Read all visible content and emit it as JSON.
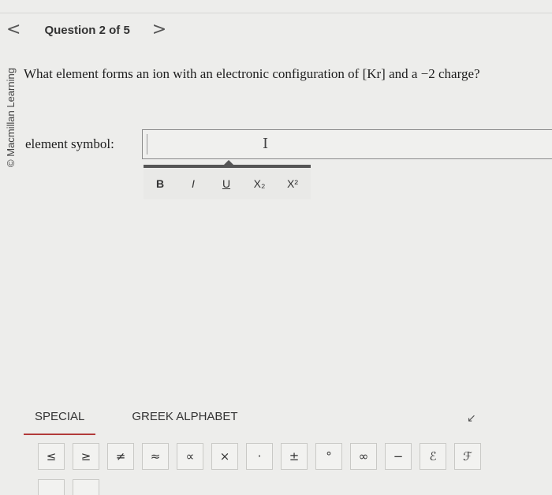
{
  "nav": {
    "prev": "<",
    "title": "Question 2 of 5",
    "next": ">"
  },
  "credit": "© Macmillan Learning",
  "question": {
    "text": "What element forms an ion with an electronic configuration of [Kr] and a −2 charge?"
  },
  "answer": {
    "label": "element symbol:",
    "value": ""
  },
  "toolbar": {
    "bold": "B",
    "italic": "I",
    "underline": "U",
    "subscript": "X₂",
    "superscript": "X²"
  },
  "palette": {
    "tabs": [
      "SPECIAL",
      "GREEK ALPHABET"
    ],
    "active_tab": "SPECIAL",
    "symbols": [
      "≤",
      "≥",
      "≠",
      "≈",
      "∝",
      "×",
      "·",
      "±",
      "°",
      "∞",
      "−",
      "ℰ",
      "ℱ"
    ]
  },
  "icons": {
    "collapse": "collapse-icon",
    "text-cursor": "ibeam-icon"
  }
}
